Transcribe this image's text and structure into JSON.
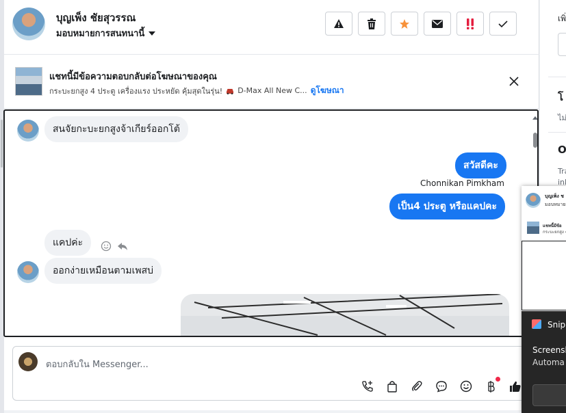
{
  "header": {
    "contact_name": "บุญเพ็ง ชัยสุวรรณ",
    "assign_label": "มอบหมายการสนทนานี้",
    "tools": [
      {
        "name": "report-spam-button",
        "icon": "warning-icon"
      },
      {
        "name": "delete-button",
        "icon": "trash-icon"
      },
      {
        "name": "star-button",
        "icon": "star-icon",
        "color": "#f7923b"
      },
      {
        "name": "mark-unread-button",
        "icon": "envelope-icon"
      },
      {
        "name": "follow-up-button",
        "icon": "double-exclamation-icon",
        "color": "#e41e3f"
      },
      {
        "name": "mark-done-button",
        "icon": "check-icon"
      }
    ]
  },
  "banner": {
    "title": "แชทนี้มีข้อความตอบกลับต่อโฆษณาของคุณ",
    "subtitle": "กระบะยกสูง 4 ประตู เครื่องแรง ประหยัด คุ้มสุดในรุ่น!",
    "ad_name": "D-Max All New C...",
    "link": "ดูโฆษณา"
  },
  "conversation": {
    "messages": [
      {
        "from": "contact",
        "text": "สนจัยกะบะยกสูงจ้าเกียร์ออกโต้"
      },
      {
        "from": "page",
        "text": "สวัสดีคะ"
      },
      {
        "from": "page",
        "sender": "Chonnikan Pimkham",
        "text": "เป็น4 ประตู หรือแคปคะ"
      },
      {
        "from": "contact",
        "text": "แคปค่ะ"
      },
      {
        "from": "contact",
        "text": "ออกง่ายเหมือนตามเพสบ่"
      }
    ]
  },
  "composer": {
    "placeholder": "ตอบกลับใน Messenger...",
    "icons": [
      "call-add-icon",
      "shopping-bag-icon",
      "attachment-icon",
      "saved-reply-icon",
      "emoji-icon",
      "baht-payment-icon",
      "thumbs-up-icon"
    ]
  },
  "right_panel": {
    "item1": "เพิ่",
    "item2": "โ",
    "item3": "ไม่",
    "item4": "O",
    "item5": "Tra",
    "item6": "inl"
  },
  "popup": {
    "name": "บุญเพ็ง ช",
    "sub": "มอบหมายก",
    "ad_title": "แชทนี้มีข้อ",
    "ad_sub": "กระบะยกสูง 4"
  },
  "toast": {
    "app": "Snip",
    "title": "Screensh",
    "subtitle": "Automa"
  }
}
